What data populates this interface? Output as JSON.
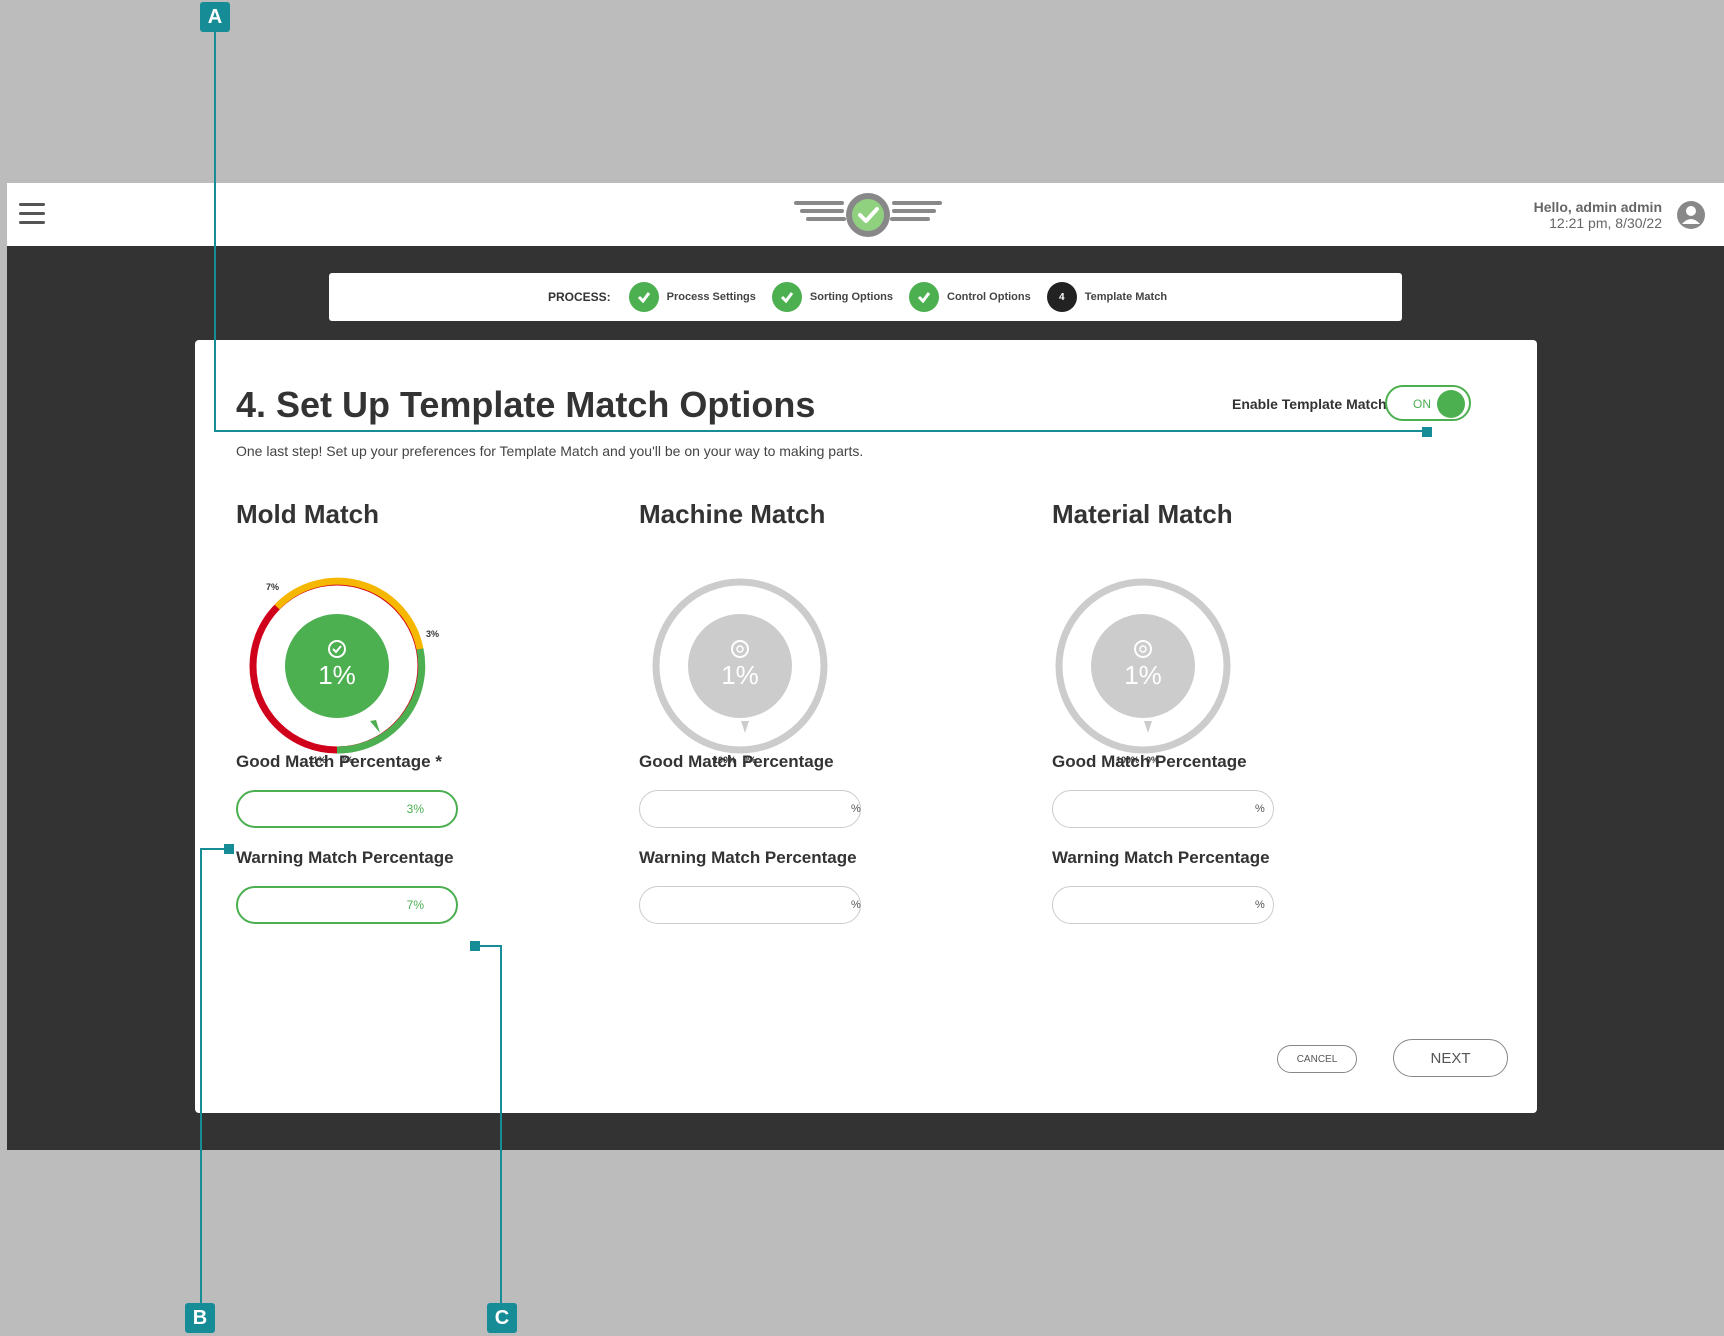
{
  "header": {
    "greeting": "Hello, admin admin",
    "timestamp": "12:21 pm, 8/30/22"
  },
  "process": {
    "label": "PROCESS:",
    "steps": [
      {
        "label": "Process Settings",
        "state": "complete"
      },
      {
        "label": "Sorting Options",
        "state": "complete"
      },
      {
        "label": "Control Options",
        "state": "complete"
      },
      {
        "label": "Template Match",
        "number": "4",
        "state": "current"
      }
    ]
  },
  "page": {
    "title": "4. Set Up Template Match Options",
    "subtitle": "One last step! Set up your preferences for Template Match and you'll be on your way to making parts.",
    "enable_label": "Enable Template Match",
    "toggle_text": "ON"
  },
  "sections": [
    {
      "title": "Mold Match",
      "gauge": {
        "center": "1%",
        "warning_label": "7%",
        "good_label": "3%",
        "bottom_left": "11%",
        "bottom_right": "0%"
      },
      "good_label": "Good Match Percentage *",
      "good_value": "3%",
      "warning_label": "Warning Match Percentage",
      "warning_value": "7%"
    },
    {
      "title": "Machine Match",
      "gauge": {
        "center": "1%",
        "bottom_left": "100%",
        "bottom_right": "0%"
      },
      "good_label": "Good Match Percentage",
      "good_suffix": "%",
      "warning_label": "Warning Match Percentage",
      "warning_suffix": "%"
    },
    {
      "title": "Material Match",
      "gauge": {
        "center": "1%",
        "bottom_left": "100%",
        "bottom_right": "0%"
      },
      "good_label": "Good Match Percentage",
      "good_suffix": "%",
      "warning_label": "Warning Match Percentage",
      "warning_suffix": "%"
    }
  ],
  "buttons": {
    "cancel": "CANCEL",
    "next": "NEXT"
  },
  "callouts": {
    "a": "A",
    "b": "B",
    "c": "C"
  },
  "colors": {
    "good": "#4caf50",
    "warning": "#f5b700",
    "bad": "#d0021b",
    "inactive": "#cccccc",
    "callout": "#168c96"
  }
}
